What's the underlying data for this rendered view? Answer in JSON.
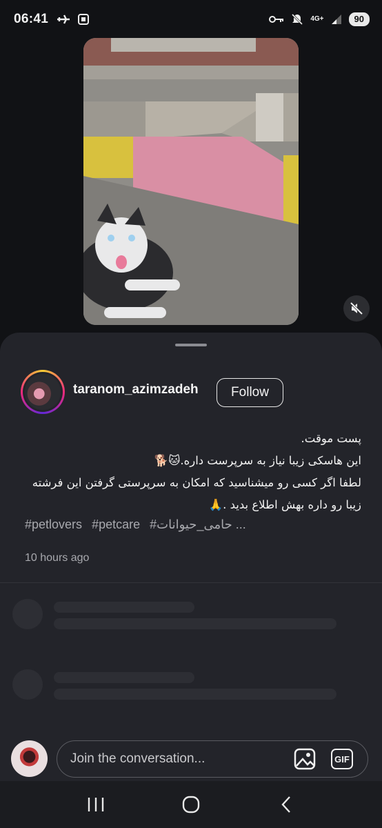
{
  "status_bar": {
    "time": "06:41",
    "network": "4G+",
    "battery": "90"
  },
  "video": {
    "muted": true
  },
  "post": {
    "username": "taranom_azimzadeh",
    "follow_label": "Follow",
    "caption_lines": [
      "پست موقت.",
      "این هاسکی زیبا نیاز به سرپرست داره.🐱🐕",
      "لطفا اگر کسی رو میشناسید که امکان به سرپرستی گرفتن این فرشته",
      "زیبا رو داره بهش اطلاع بدید .🙏"
    ],
    "hashtags": [
      "#petlovers",
      "#petcare",
      "#حامی_حیوانات ..."
    ],
    "time_ago": "10 hours ago"
  },
  "composer": {
    "placeholder": "Join the conversation...",
    "gif_label": "GIF"
  },
  "icons": {
    "mute": "speaker-muted-icon",
    "image": "image-icon",
    "gif": "gif-icon",
    "nav_recent": "recent-apps-icon",
    "nav_home": "home-icon",
    "nav_back": "back-icon"
  }
}
